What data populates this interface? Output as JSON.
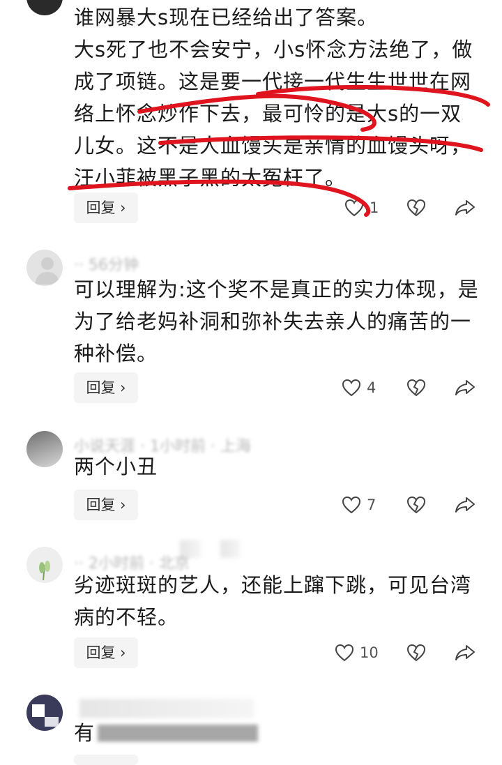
{
  "comments": [
    {
      "text": "谁网暴大s现在已经给出了答案。\n大s死了也不会安宁，小s怀念方法绝了，做成了项链。这是要一代接一代生生世世在网络上怀念炒作下去，最可怜的是大s的一双儿女。这不是人血馒头是亲情的血馒头呀，汪小菲被黑子黑的太冤枉了。",
      "reply_label": "回复 ›",
      "likes": "1"
    },
    {
      "meta": "·· 56分钟",
      "text": "可以理解为:这个奖不是真正的实力体现，是为了给老妈补洞和弥补失去亲人的痛苦的一种补偿。",
      "reply_label": "回复 ›",
      "likes": "4"
    },
    {
      "meta": "小说天涯 · 1小时前 · 上海",
      "text": "两个小丑",
      "reply_label": "回复 ›",
      "likes": "7"
    },
    {
      "meta": "·· 2小时前 · 北京",
      "text": "劣迹斑斑的艺人，还能上蹿下跳，可见台湾病的不轻。",
      "reply_label": "回复 ›",
      "likes": "10"
    },
    {
      "text": "有",
      "reply_label": "回复 ›"
    }
  ],
  "icons": {
    "like": "heart-outline-icon",
    "dislike": "broken-heart-icon",
    "share": "share-arrow-icon"
  },
  "colors": {
    "scribble": "#e0141e"
  }
}
